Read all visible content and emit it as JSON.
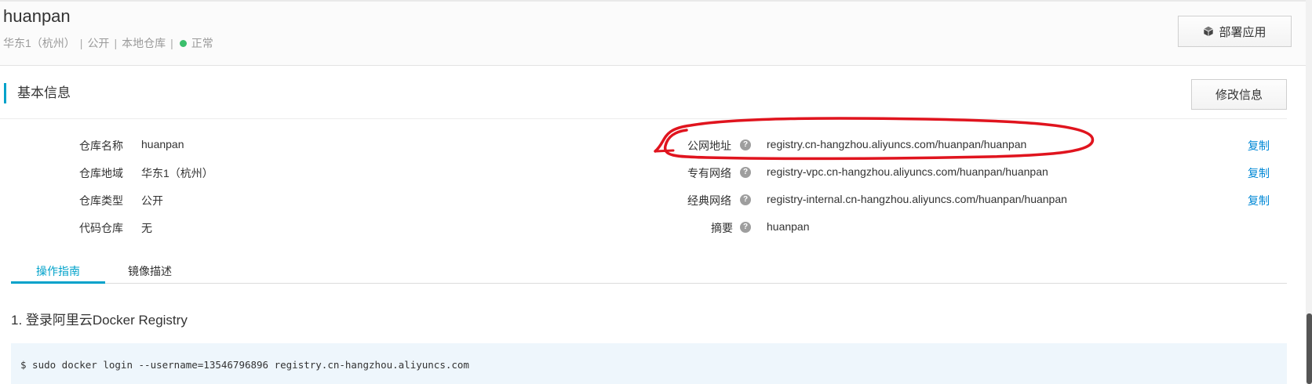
{
  "header": {
    "title": "huanpan",
    "region": "华东1（杭州）",
    "visibility": "公开",
    "source": "本地仓库",
    "status": "正常",
    "deploy_button": "部署应用",
    "deploy_icon": "cube-icon",
    "status_color": "#3bbf6c"
  },
  "basic_info": {
    "title": "基本信息",
    "edit_button": "修改信息",
    "left": [
      {
        "label": "仓库名称",
        "value": "huanpan"
      },
      {
        "label": "仓库地域",
        "value": "华东1（杭州）"
      },
      {
        "label": "仓库类型",
        "value": "公开"
      },
      {
        "label": "代码仓库",
        "value": "无"
      }
    ],
    "right": [
      {
        "label": "公网地址",
        "value": "registry.cn-hangzhou.aliyuncs.com/huanpan/huanpan",
        "copy": "复制"
      },
      {
        "label": "专有网络",
        "value": "registry-vpc.cn-hangzhou.aliyuncs.com/huanpan/huanpan",
        "copy": "复制"
      },
      {
        "label": "经典网络",
        "value": "registry-internal.cn-hangzhou.aliyuncs.com/huanpan/huanpan",
        "copy": "复制"
      },
      {
        "label": "摘要",
        "value": "huanpan"
      }
    ],
    "help_glyph": "?"
  },
  "tabs": [
    {
      "label": "操作指南",
      "active": true
    },
    {
      "label": "镜像描述",
      "active": false
    }
  ],
  "guide": {
    "step1_title": "1. 登录阿里云Docker Registry",
    "step1_code": "$ sudo docker login --username=13546796896 registry.cn-hangzhou.aliyuncs.com"
  },
  "colors": {
    "accent": "#00a2ca",
    "link": "#0088d6",
    "annotation": "#e0141e",
    "code_bg": "#eef6fc"
  }
}
